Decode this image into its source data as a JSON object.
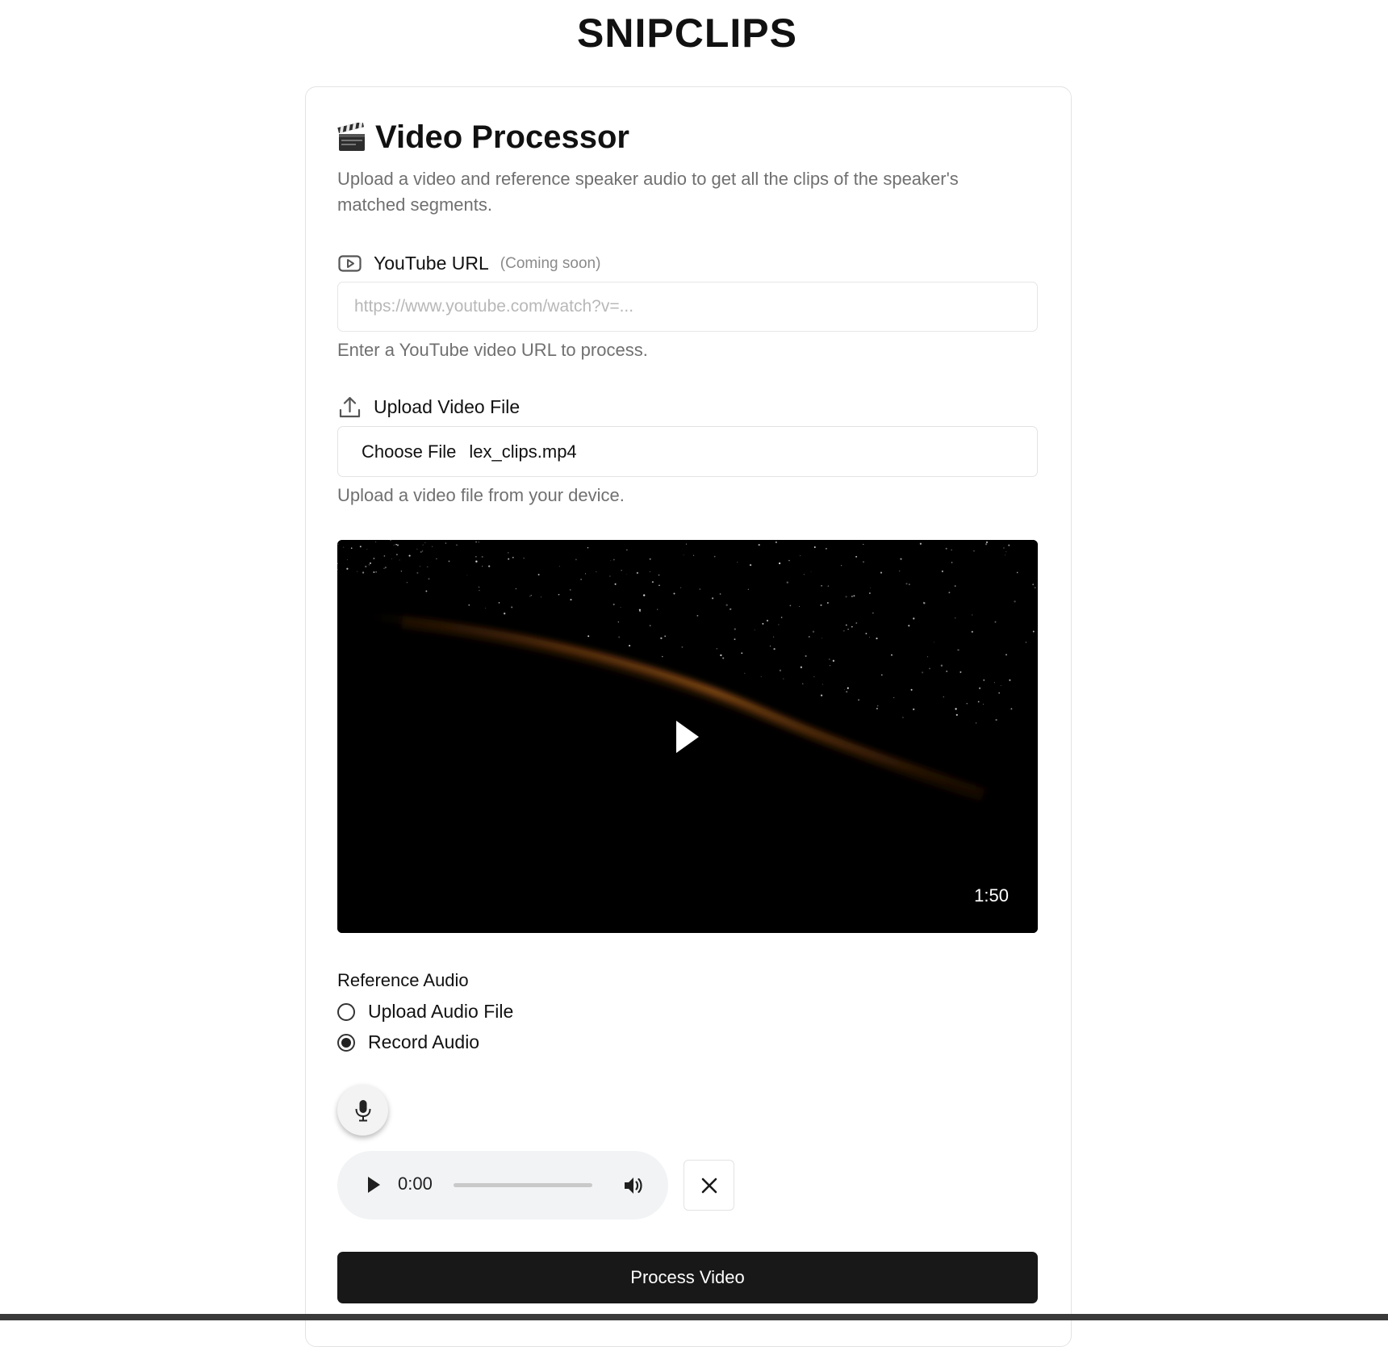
{
  "app": {
    "title": "SNIPCLIPS"
  },
  "processor": {
    "title": "Video Processor",
    "description": "Upload a video and reference speaker audio to get all the clips of the speaker's matched segments."
  },
  "youtube": {
    "label": "YouTube URL",
    "note": "(Coming soon)",
    "placeholder": "https://www.youtube.com/watch?v=...",
    "value": "",
    "hint": "Enter a YouTube video URL to process."
  },
  "upload": {
    "label": "Upload Video File",
    "button_label": "Choose File",
    "file_name": "lex_clips.mp4",
    "hint": "Upload a video file from your device."
  },
  "video": {
    "duration": "1:50"
  },
  "reference_audio": {
    "label": "Reference Audio",
    "options": [
      {
        "label": "Upload Audio File",
        "selected": false
      },
      {
        "label": "Record Audio",
        "selected": true
      }
    ]
  },
  "audio_player": {
    "current_time": "0:00",
    "progress": 0
  },
  "actions": {
    "process_label": "Process Video"
  },
  "icons": {
    "heading": "clapperboard-icon",
    "youtube": "youtube-icon",
    "upload": "upload-icon",
    "mic": "microphone-icon",
    "close": "close-icon",
    "play": "play-icon",
    "volume": "volume-icon"
  },
  "colors": {
    "primary_button": "#181818",
    "muted_text": "#707070",
    "audio_player_bg": "#f1f3f4"
  }
}
